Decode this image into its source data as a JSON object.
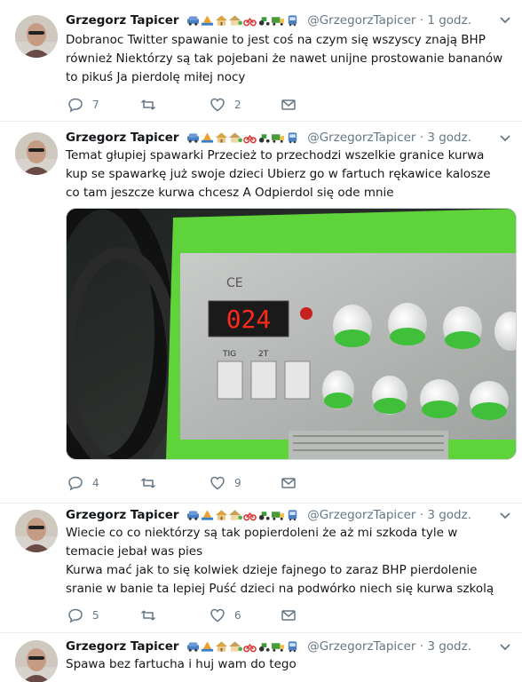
{
  "tweets": [
    {
      "author": "Grzegorz Tapicer",
      "handle": "@GrzegorzTapicer",
      "time": "· 1 godz.",
      "text": [
        "Dobranoc Twitter spawanie to jest coś na czym się wszyscy znają BHP również Niektórzy są tak pojebani że nawet unijne prostowanie bananów to pikuś Ja pierdolę miłej nocy"
      ],
      "replies": "7",
      "retweets": "",
      "likes": "2"
    },
    {
      "author": "Grzegorz Tapicer",
      "handle": "@GrzegorzTapicer",
      "time": "· 3 godz.",
      "text": [
        "Temat głupiej spawarki Przecież to przechodzi wszelkie granice kurwa kup se spawarkę już swoje dzieci Ubierz go w fartuch rękawice kalosze co tam jeszcze kurwa chcesz A Odpierdol się ode mnie"
      ],
      "media": {
        "display_value": "024",
        "labels": [
          "TIG",
          "2T"
        ]
      },
      "replies": "4",
      "retweets": "",
      "likes": "9"
    },
    {
      "author": "Grzegorz Tapicer",
      "handle": "@GrzegorzTapicer",
      "time": "· 3 godz.",
      "text": [
        "Wiecie co co niektórzy są tak popierdoleni że aż mi szkoda tyle w temacie jebał was pies",
        "Kurwa mać jak to się kolwiek dzieje fajnego to zaraz BHP pierdolenie sranie w banie ta lepiej Puść dzieci na podwórko niech się kurwa szkolą"
      ],
      "replies": "5",
      "retweets": "",
      "likes": "6"
    },
    {
      "author": "Grzegorz Tapicer",
      "handle": "@GrzegorzTapicer",
      "time": "· 3 godz.",
      "text": [
        "Spawa bez fartucha i huj wam do tego"
      ]
    }
  ],
  "icons": [
    "reply-icon",
    "retweet-icon",
    "like-icon",
    "message-icon",
    "chevron-down-icon"
  ],
  "colors": {
    "action_gray": "#657786",
    "text": "#14171a",
    "divider": "#e6ecf0",
    "display_red": "#ff2a1a",
    "knob_green": "#3fbf3a"
  }
}
